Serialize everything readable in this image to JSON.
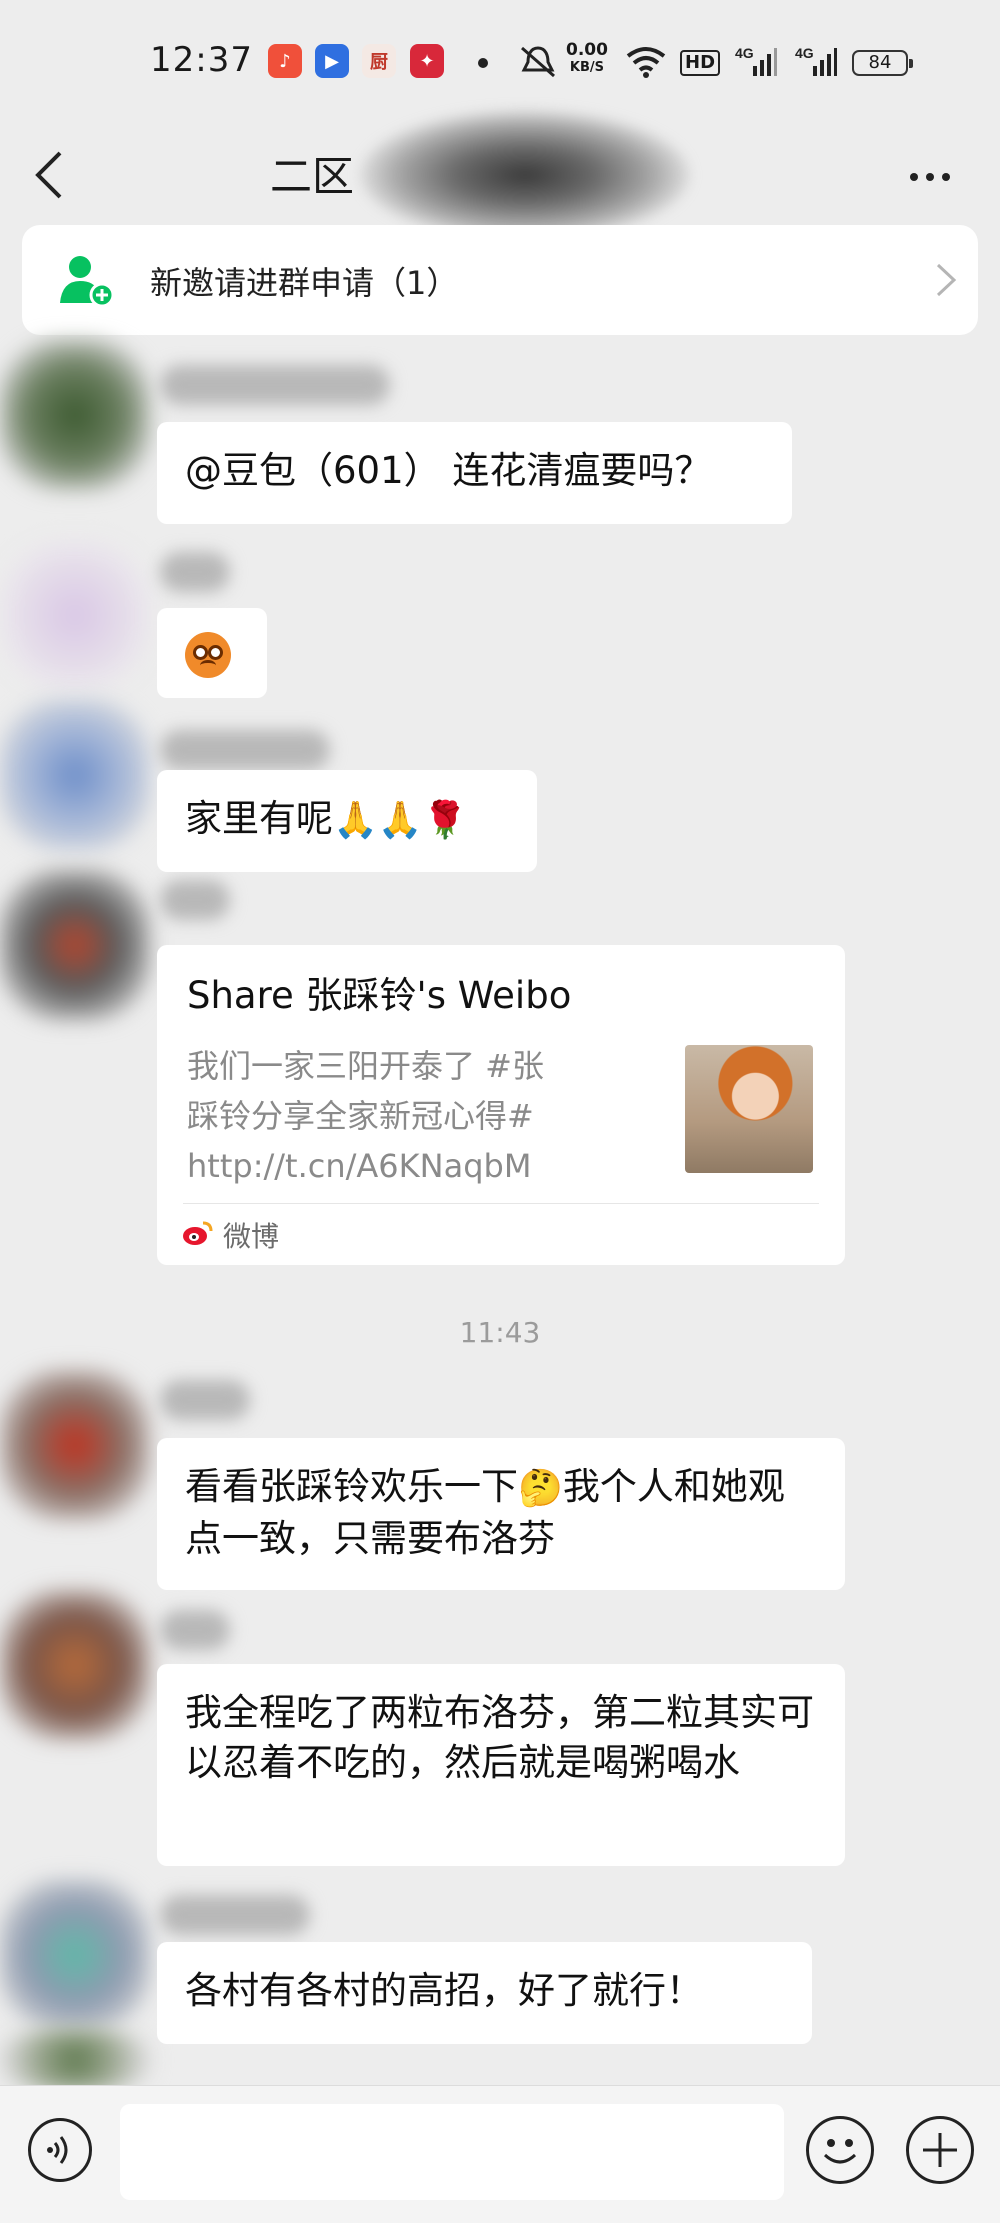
{
  "status_bar": {
    "time": "12:37",
    "net_speed_value": "0.00",
    "net_speed_unit": "KB/S",
    "hd_label": "HD",
    "signal_label_1": "4G",
    "signal_label_2": "4G",
    "battery": "84"
  },
  "nav": {
    "title": "二区",
    "back_icon": "chevron-left-icon",
    "more_icon": "more-dots-icon"
  },
  "invite": {
    "label": "新邀请进群申请（1）",
    "icon": "add-member-icon",
    "accent": "#07c160"
  },
  "messages": [
    {
      "text": "@豆包（601） 连花清瘟要吗？"
    },
    {
      "emoji": "sad-face-emoji"
    },
    {
      "text": "家里有呢",
      "emoji": [
        "pray-hands",
        "pray-hands",
        "rose"
      ]
    },
    {
      "text_1": "看看张踩铃欢乐一下",
      "emoji": "thinking-face",
      "text_2": "我个人和她观点一致，只需要布洛芬"
    },
    {
      "text": "我全程吃了两粒布洛芬，第二粒其实可以忍着不吃的，然后就是喝粥喝水"
    },
    {
      "text": "各村有各村的高招，好了就行！"
    }
  ],
  "share": {
    "title": "Share 张踩铃's Weibo",
    "description": "我们一家三阳开泰了 #张踩铃分享全家新冠心得# http://t.cn/A6KNaqbM",
    "source": "微博",
    "source_icon": "weibo-icon"
  },
  "timestamp": "11:43",
  "input_bar": {
    "voice_icon": "voice-icon",
    "emoji_icon": "emoji-icon",
    "plus_icon": "plus-icon"
  }
}
